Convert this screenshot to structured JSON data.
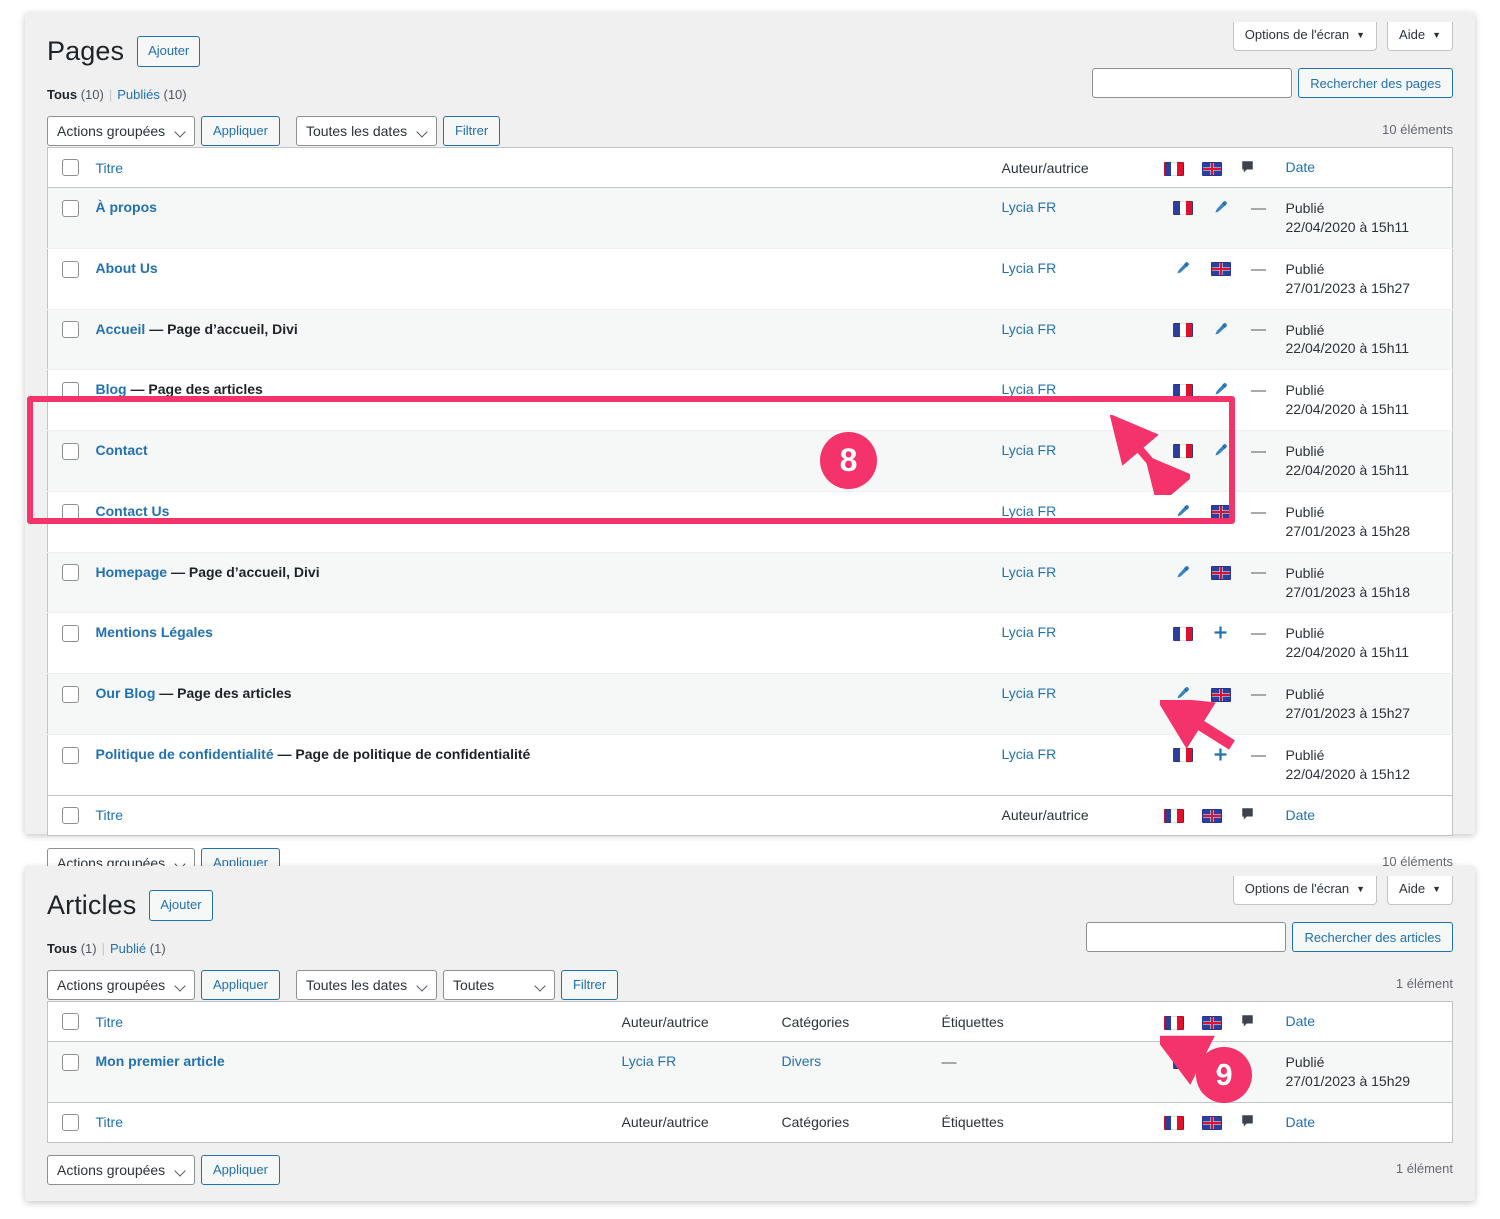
{
  "pages_panel": {
    "screen_options_label": "Options de l'écran",
    "help_label": "Aide",
    "title": "Pages",
    "add_label": "Ajouter",
    "views": {
      "all_label": "Tous",
      "all_count": "(10)",
      "published_label": "Publiés",
      "published_count": "(10)"
    },
    "bulk_actions_label": "Actions groupées",
    "apply_label": "Appliquer",
    "dates_filter_label": "Toutes les dates",
    "filter_label": "Filtrer",
    "search_placeholder": "",
    "search_value": "",
    "search_submit_label": "Rechercher des pages",
    "displaying_num": "10 éléments",
    "columns": {
      "title": "Titre",
      "author": "Auteur/autrice",
      "lang_fr": "flag-fr-icon",
      "lang_gb": "flag-gb-icon",
      "comments": "comment-bubble-icon",
      "date": "Date"
    },
    "rows": [
      {
        "title": "À propos",
        "state": "",
        "author": "Lycia FR",
        "col_fr": "flag-fr",
        "col_gb": "pencil",
        "comments": "—",
        "date_status": "Publié",
        "date_value": "22/04/2020 à 15h11"
      },
      {
        "title": "About Us",
        "state": "",
        "author": "Lycia FR",
        "col_fr": "pencil",
        "col_gb": "flag-gb",
        "comments": "—",
        "date_status": "Publié",
        "date_value": "27/01/2023 à 15h27"
      },
      {
        "title": "Accueil",
        "state": "— Page d’accueil, Divi",
        "author": "Lycia FR",
        "col_fr": "flag-fr",
        "col_gb": "pencil",
        "comments": "—",
        "date_status": "Publié",
        "date_value": "22/04/2020 à 15h11"
      },
      {
        "title": "Blog",
        "state": "— Page des articles",
        "author": "Lycia FR",
        "col_fr": "flag-fr",
        "col_gb": "pencil",
        "comments": "—",
        "date_status": "Publié",
        "date_value": "22/04/2020 à 15h11"
      },
      {
        "title": "Contact",
        "state": "",
        "author": "Lycia FR",
        "col_fr": "flag-fr",
        "col_gb": "pencil",
        "comments": "—",
        "date_status": "Publié",
        "date_value": "22/04/2020 à 15h11"
      },
      {
        "title": "Contact Us",
        "state": "",
        "author": "Lycia FR",
        "col_fr": "pencil",
        "col_gb": "flag-gb",
        "comments": "—",
        "date_status": "Publié",
        "date_value": "27/01/2023 à 15h28"
      },
      {
        "title": "Homepage",
        "state": "— Page d’accueil, Divi",
        "author": "Lycia FR",
        "col_fr": "pencil",
        "col_gb": "flag-gb",
        "comments": "—",
        "date_status": "Publié",
        "date_value": "27/01/2023 à 15h18"
      },
      {
        "title": "Mentions Légales",
        "state": "",
        "author": "Lycia FR",
        "col_fr": "flag-fr",
        "col_gb": "plus",
        "comments": "—",
        "date_status": "Publié",
        "date_value": "22/04/2020 à 15h11"
      },
      {
        "title": "Our Blog",
        "state": "— Page des articles",
        "author": "Lycia FR",
        "col_fr": "pencil",
        "col_gb": "flag-gb",
        "comments": "—",
        "date_status": "Publié",
        "date_value": "27/01/2023 à 15h27"
      },
      {
        "title": "Politique de confidentialité",
        "state": "— Page de politique de confidentialité",
        "author": "Lycia FR",
        "col_fr": "flag-fr",
        "col_gb": "plus",
        "comments": "—",
        "date_status": "Publié",
        "date_value": "22/04/2020 à 15h12"
      }
    ],
    "bottom_bulk_actions_label": "Actions groupées",
    "bottom_apply_label": "Appliquer",
    "bottom_displaying_num": "10 éléments"
  },
  "posts_panel": {
    "screen_options_label": "Options de l'écran",
    "help_label": "Aide",
    "title": "Articles",
    "add_label": "Ajouter",
    "views": {
      "all_label": "Tous",
      "all_count": "(1)",
      "published_label": "Publié",
      "published_count": "(1)"
    },
    "bulk_actions_label": "Actions groupées",
    "apply_label": "Appliquer",
    "dates_filter_label": "Toutes les dates",
    "cats_filter_label": "Toutes",
    "filter_label": "Filtrer",
    "search_placeholder": "",
    "search_value": "",
    "search_submit_label": "Rechercher des articles",
    "displaying_num": "1 élément",
    "columns": {
      "title": "Titre",
      "author": "Auteur/autrice",
      "categories": "Catégories",
      "tags": "Étiquettes",
      "lang_fr": "flag-fr-icon",
      "lang_gb": "flag-gb-icon",
      "comments": "comment-bubble-icon",
      "date": "Date"
    },
    "rows": [
      {
        "title": "Mon premier article",
        "author": "Lycia FR",
        "categories": "Divers",
        "tags": "—",
        "col_fr": "flag-fr",
        "col_gb": "plus",
        "date_status": "Publié",
        "date_value": "27/01/2023 à 15h29"
      }
    ],
    "bottom_bulk_actions_label": "Actions groupées",
    "bottom_apply_label": "Appliquer",
    "bottom_displaying_num": "1 élément"
  },
  "annotations": {
    "accent_color": "#f4336b",
    "badge_8": "8",
    "badge_9": "9"
  }
}
